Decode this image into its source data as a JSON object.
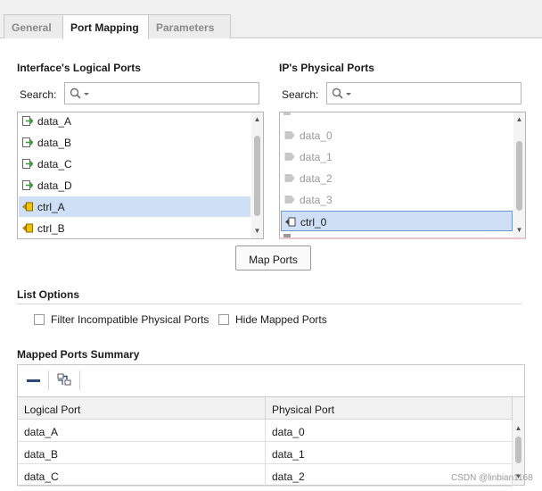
{
  "tabs": [
    {
      "label": "General",
      "active": false
    },
    {
      "label": "Port Mapping",
      "active": true
    },
    {
      "label": "Parameters",
      "active": false
    }
  ],
  "logical": {
    "title": "Interface's Logical Ports",
    "search_label": "Search:",
    "search_value": "",
    "items": [
      {
        "label": "data_A",
        "kind": "input"
      },
      {
        "label": "data_B",
        "kind": "input"
      },
      {
        "label": "data_C",
        "kind": "input"
      },
      {
        "label": "data_D",
        "kind": "input"
      },
      {
        "label": "ctrl_A",
        "kind": "clock",
        "selected": true
      },
      {
        "label": "ctrl_B",
        "kind": "clock"
      }
    ]
  },
  "physical": {
    "title": "IP's Physical Ports",
    "search_label": "Search:",
    "search_value": "",
    "items": [
      {
        "label": "data_0",
        "dimmed": true
      },
      {
        "label": "data_1",
        "dimmed": true
      },
      {
        "label": "data_2",
        "dimmed": true
      },
      {
        "label": "data_3",
        "dimmed": true
      },
      {
        "label": "ctrl_0",
        "selected": true
      }
    ]
  },
  "map_ports_label": "Map Ports",
  "list_options": {
    "title": "List Options",
    "filter_label": "Filter Incompatible Physical Ports",
    "filter_checked": false,
    "hide_label": "Hide Mapped Ports",
    "hide_checked": false
  },
  "summary": {
    "title": "Mapped Ports Summary",
    "columns": [
      "Logical Port",
      "Physical Port"
    ],
    "rows": [
      [
        "data_A",
        "data_0"
      ],
      [
        "data_B",
        "data_1"
      ],
      [
        "data_C",
        "data_2"
      ]
    ]
  },
  "watermark": "CSDN @linbian1168",
  "colors": {
    "selection": "#cfe0f6",
    "selection_border": "#6a9ad6",
    "port_in": "#4caf50",
    "port_clock": "#e6b800"
  },
  "icons": [
    "search-icon",
    "dropdown-caret-icon",
    "input-port-icon",
    "clock-port-icon",
    "remove-icon",
    "auto-map-icon"
  ]
}
